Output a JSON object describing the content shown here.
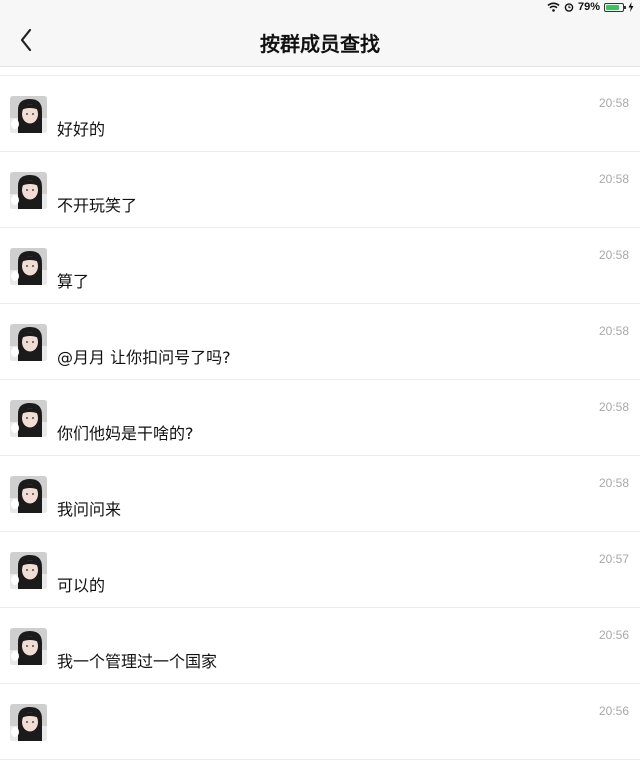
{
  "status_bar": {
    "battery_percent_label": "79%",
    "battery_level": 0.79,
    "icons": [
      "wifi-icon",
      "alarm-icon",
      "battery-icon",
      "charging-icon"
    ]
  },
  "header": {
    "title": "按群成员查找",
    "back_icon": "chevron-left-icon"
  },
  "messages": [
    {
      "text": "好好的",
      "time": "20:58"
    },
    {
      "text": "不开玩笑了",
      "time": "20:58"
    },
    {
      "text": "算了",
      "time": "20:58"
    },
    {
      "text": "@月月 让你扣问号了吗?",
      "time": "20:58"
    },
    {
      "text": "你们他妈是干啥的?",
      "time": "20:58"
    },
    {
      "text": "我问问来",
      "time": "20:58"
    },
    {
      "text": "可以的",
      "time": "20:57"
    },
    {
      "text": "我一个管理过一个国家",
      "time": "20:56"
    },
    {
      "text": "",
      "time": "20:56"
    }
  ],
  "colors": {
    "nav_background": "#f7f7f7",
    "divider": "#ececec",
    "time_text": "#a8a8a8",
    "battery_fill": "#35c759"
  }
}
